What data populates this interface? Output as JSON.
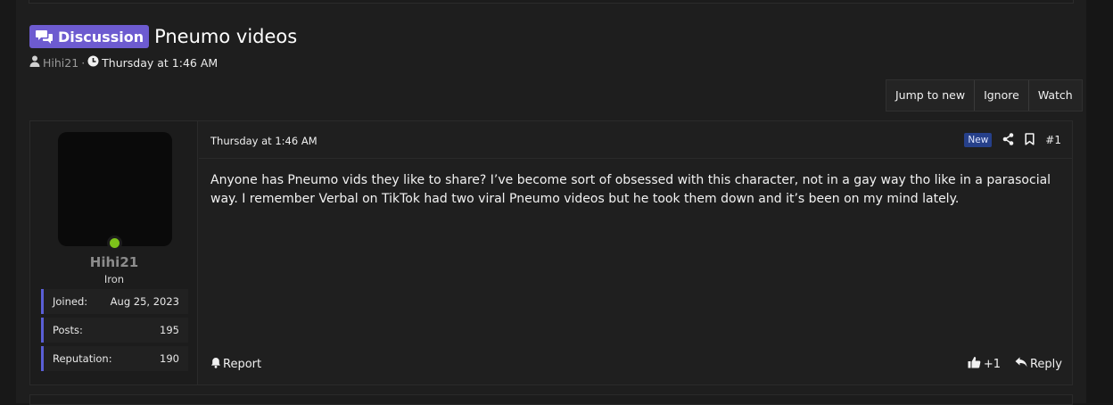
{
  "thread": {
    "prefix": "Discussion",
    "title": "Pneumo videos",
    "author": "Hihi21",
    "separator": "·",
    "date": "Thursday at 1:46 AM"
  },
  "toolbar": {
    "jump_to_new": "Jump to new",
    "ignore": "Ignore",
    "watch": "Watch"
  },
  "post": {
    "user": {
      "name": "Hihi21",
      "rank": "Iron",
      "stats": [
        {
          "label": "Joined:",
          "value": "Aug 25, 2023"
        },
        {
          "label": "Posts:",
          "value": "195"
        },
        {
          "label": "Reputation:",
          "value": "190"
        }
      ]
    },
    "date": "Thursday at 1:46 AM",
    "new_badge": "New",
    "number": "#1",
    "body": "Anyone has Pneumo vids they like to share? I’ve become sort of obsessed with this character, not in a gay way tho like in a parasocial way. I remember Verbal on TikTok had two viral Pneumo videos but he took them down and it’s been on my mind lately.",
    "report_label": "Report",
    "reaction_count": "+1",
    "reply_label": "Reply"
  },
  "colors": {
    "prefix_badge": "#6d5bd0",
    "online": "#7cc21a",
    "stat_accent": "#5a5fd6",
    "new_badge": "#26408a"
  },
  "icons": [
    "comments-icon",
    "user-icon",
    "clock-icon",
    "share-icon",
    "bookmark-icon",
    "bell-icon",
    "thumbs-up-icon",
    "reply-icon"
  ]
}
